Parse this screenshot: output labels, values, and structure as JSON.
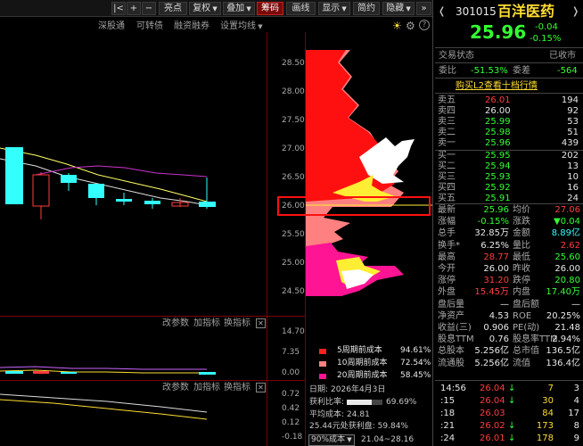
{
  "toolbar": {
    "nav_left": "|<",
    "add": "+",
    "minus": "−",
    "highlight": "亮点",
    "fuquan": "复权",
    "overlay": "叠加",
    "chouma": "筹码",
    "drawline": "画线",
    "display": "显示",
    "jianyue": "简约",
    "hide": "隐藏",
    "more": "»"
  },
  "subtabs": {
    "shenguto": "深股通",
    "convertible": "可转债",
    "margin": "融资融券",
    "setlines": "设置均线"
  },
  "price_axis": [
    "28.50",
    "28.00",
    "27.50",
    "27.00",
    "26.50",
    "26.00",
    "25.50",
    "25.00",
    "24.50"
  ],
  "indicator1": {
    "change_param": "改参数",
    "add_indicator": "加指标",
    "switch_indicator": "换指标",
    "ticks": [
      "14.70",
      "7.35",
      "0.00"
    ]
  },
  "indicator2": {
    "change_param": "改参数",
    "add_indicator": "加指标",
    "switch_indicator": "换指标",
    "ticks": [
      "0.72",
      "0.42",
      "0.12",
      "-0.18"
    ]
  },
  "cost_legend": [
    {
      "label": "5周期前成本",
      "value": "94.61%",
      "color": "#ff2020"
    },
    {
      "label": "10周期前成本",
      "value": "72.54%",
      "color": "#ff8080"
    },
    {
      "label": "20周期前成本",
      "value": "58.45%",
      "color": "#ff1493"
    }
  ],
  "chip_info": {
    "date_label": "日期:",
    "date": "2026年4月3日",
    "profit_label": "获利比率:",
    "profit_value": "69.69%",
    "profit_fraction": 0.6969,
    "avg_cost_label": "平均成本:",
    "avg_cost": "24.81",
    "profit_line": "25.44元处获利盘: 59.84%",
    "cost_select": "90%成本",
    "cost_range": "21.04~28.16"
  },
  "stock": {
    "code": "301015",
    "name": "百洋医药",
    "price": "25.96",
    "change": "-0.04",
    "pct": "-0.15%",
    "status_label": "交易状态",
    "status": "已收市",
    "weibi_label": "委比",
    "weibi": "-51.53%",
    "weicha_label": "委差",
    "weicha": "-564",
    "l2_link": "购买L2查看十档行情"
  },
  "asks": [
    {
      "label": "卖五",
      "price": "26.01",
      "vol": "194"
    },
    {
      "label": "卖四",
      "price": "26.00",
      "vol": "92"
    },
    {
      "label": "卖三",
      "price": "25.99",
      "vol": "53"
    },
    {
      "label": "卖二",
      "price": "25.98",
      "vol": "51"
    },
    {
      "label": "卖一",
      "price": "25.96",
      "vol": "439"
    }
  ],
  "bids": [
    {
      "label": "买一",
      "price": "25.95",
      "vol": "202"
    },
    {
      "label": "买二",
      "price": "25.94",
      "vol": "13"
    },
    {
      "label": "买三",
      "price": "25.93",
      "vol": "10"
    },
    {
      "label": "买四",
      "price": "25.92",
      "vol": "16"
    },
    {
      "label": "买五",
      "price": "25.91",
      "vol": "24"
    }
  ],
  "stats": [
    {
      "l1": "最新",
      "v1": "25.96",
      "c1": "#33ff33",
      "l2": "均价",
      "v2": "27.06",
      "c2": "#ff3c3c"
    },
    {
      "l1": "涨幅",
      "v1": "-0.15%",
      "c1": "#33ff33",
      "l2": "涨跌",
      "v2": "▼0.04",
      "c2": "#33ff33"
    },
    {
      "l1": "总手",
      "v1": "32.85万",
      "c1": "#e8e8e8",
      "l2": "金额",
      "v2": "8.89亿",
      "c2": "#33ffff"
    },
    {
      "l1": "换手*",
      "v1": "6.25%",
      "c1": "#e8e8e8",
      "l2": "量比",
      "v2": "2.62",
      "c2": "#ff3c3c"
    },
    {
      "l1": "最高",
      "v1": "28.77",
      "c1": "#ff3c3c",
      "l2": "最低",
      "v2": "25.60",
      "c2": "#33ff33"
    },
    {
      "l1": "今开",
      "v1": "26.00",
      "c1": "#e8e8e8",
      "l2": "昨收",
      "v2": "26.00",
      "c2": "#e8e8e8"
    },
    {
      "l1": "涨停",
      "v1": "31.20",
      "c1": "#ff3c3c",
      "l2": "跌停",
      "v2": "20.80",
      "c2": "#33ff33"
    },
    {
      "l1": "外盘",
      "v1": "15.45万",
      "c1": "#ff3c3c",
      "l2": "内盘",
      "v2": "17.40万",
      "c2": "#33ff33"
    },
    {
      "l1": "盘后量",
      "v1": "—",
      "c1": "#e8e8e8",
      "l2": "盘后额",
      "v2": "—",
      "c2": "#e8e8e8"
    },
    {
      "l1": "净资产",
      "v1": "4.53",
      "c1": "#e8e8e8",
      "l2": "ROE",
      "v2": "20.25%",
      "c2": "#e8e8e8"
    },
    {
      "l1": "收益(三)",
      "v1": "0.906",
      "c1": "#e8e8e8",
      "l2": "PE(动)",
      "v2": "21.48",
      "c2": "#e8e8e8"
    },
    {
      "l1": "股息TTM",
      "v1": "0.76",
      "c1": "#e8e8e8",
      "l2": "股息率TTM",
      "v2": "2.94%",
      "c2": "#e8e8e8"
    },
    {
      "l1": "总股本",
      "v1": "5.256亿",
      "c1": "#e8e8e8",
      "l2": "总市值",
      "v2": "136.5亿",
      "c2": "#e8e8e8"
    },
    {
      "l1": "流通股",
      "v1": "5.256亿",
      "c1": "#e8e8e8",
      "l2": "流值",
      "v2": "136.4亿",
      "c2": "#e8e8e8"
    }
  ],
  "ticks": [
    {
      "time": "14:56",
      "price": "26.04",
      "arrow": "↓",
      "vol": "7",
      "n": "3",
      "color": "#ff3c3c"
    },
    {
      "time": ":15",
      "price": "26.04",
      "arrow": "↓",
      "vol": "30",
      "n": "4",
      "color": "#ff3c3c"
    },
    {
      "time": ":18",
      "price": "26.03",
      "arrow": "",
      "vol": "84",
      "n": "17",
      "color": "#ff3c3c"
    },
    {
      "time": ":21",
      "price": "26.02",
      "arrow": "↓",
      "vol": "173",
      "n": "8",
      "color": "#ff3c3c"
    },
    {
      "time": ":24",
      "price": "26.01",
      "arrow": "↓",
      "vol": "178",
      "n": "9",
      "color": "#ff3c3c"
    }
  ],
  "colors": {
    "up": "#ff3c3c",
    "down": "#33ff33",
    "cyan": "#33ffff",
    "grid": "#7a0000",
    "highlight_box": "#ff1010"
  }
}
